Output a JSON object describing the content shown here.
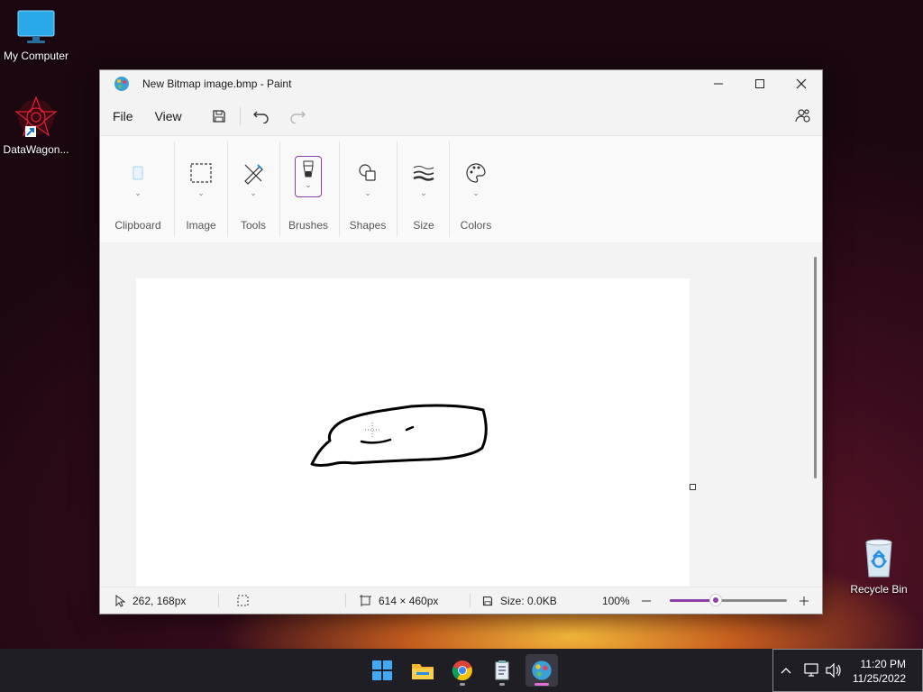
{
  "desktop": {
    "icons": [
      {
        "label": "My Computer"
      },
      {
        "label": "DataWagon..."
      },
      {
        "label": "Recycle Bin"
      }
    ]
  },
  "window": {
    "title": "New Bitmap image.bmp - Paint",
    "menu": {
      "file": "File",
      "view": "View"
    },
    "ribbon": {
      "groups": [
        {
          "label": "Clipboard",
          "icon": "clipboard-icon"
        },
        {
          "label": "Image",
          "icon": "select-icon"
        },
        {
          "label": "Tools",
          "icon": "tools-icon"
        },
        {
          "label": "Brushes",
          "icon": "brush-icon"
        },
        {
          "label": "Shapes",
          "icon": "shapes-icon"
        },
        {
          "label": "Size",
          "icon": "size-icon"
        },
        {
          "label": "Colors",
          "icon": "palette-icon"
        }
      ]
    },
    "status": {
      "cursor_pos": "262, 168px",
      "canvas_size": "614 × 460px",
      "file_size": "Size: 0.0KB",
      "zoom": "100%",
      "zoom_fraction": 0.39
    }
  },
  "taskbar": {
    "apps": [
      "start-icon",
      "file-explorer-icon",
      "chrome-icon",
      "notepad-icon",
      "paint-icon"
    ],
    "active_app": "paint-icon",
    "time": "11:20 PM",
    "date": "11/25/2022"
  },
  "colors": {
    "accent": "#8c3fa8",
    "taskbar": "#1e1e24"
  }
}
